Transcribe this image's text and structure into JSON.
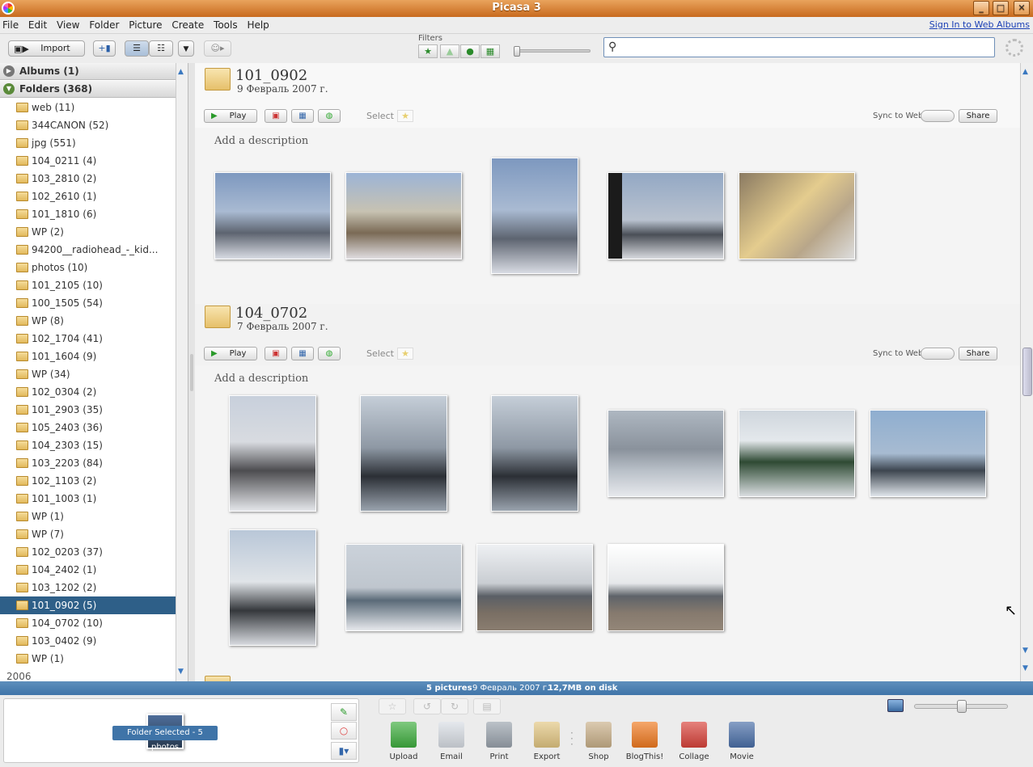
{
  "window": {
    "title": "Picasa 3",
    "min": "_",
    "max": "□",
    "close": "✕"
  },
  "menu": {
    "items": [
      "File",
      "Edit",
      "View",
      "Folder",
      "Picture",
      "Create",
      "Tools",
      "Help"
    ],
    "signin": "Sign In to Web Albums"
  },
  "toolbar": {
    "import": "Import",
    "filters_label": "Filters",
    "search_value": "",
    "search_placeholder": ""
  },
  "sidebar": {
    "albums": "Albums (1)",
    "folders": "Folders (368)",
    "items": [
      {
        "label": "web (11)"
      },
      {
        "label": "344CANON (52)"
      },
      {
        "label": "jpg (551)"
      },
      {
        "label": "104_0211 (4)"
      },
      {
        "label": "103_2810 (2)"
      },
      {
        "label": "102_2610 (1)"
      },
      {
        "label": "101_1810 (6)"
      },
      {
        "label": "WP (2)"
      },
      {
        "label": "94200__radiohead_-_kid..."
      },
      {
        "label": "photos (10)"
      },
      {
        "label": "101_2105 (10)"
      },
      {
        "label": "100_1505 (54)"
      },
      {
        "label": "WP (8)"
      },
      {
        "label": "102_1704 (41)"
      },
      {
        "label": "101_1604 (9)"
      },
      {
        "label": "WP (34)"
      },
      {
        "label": "102_0304 (2)"
      },
      {
        "label": "101_2903 (35)"
      },
      {
        "label": "105_2403 (36)"
      },
      {
        "label": "104_2303 (15)"
      },
      {
        "label": "103_2203 (84)"
      },
      {
        "label": "102_1103 (2)"
      },
      {
        "label": "101_1003 (1)"
      },
      {
        "label": "WP (1)"
      },
      {
        "label": "WP (7)"
      },
      {
        "label": "102_0203 (37)"
      },
      {
        "label": "104_2402 (1)"
      },
      {
        "label": "103_1202 (2)"
      },
      {
        "label": "101_0902 (5)",
        "selected": true
      },
      {
        "label": "104_0702 (10)"
      },
      {
        "label": "103_0402 (9)"
      },
      {
        "label": "WP (1)"
      }
    ],
    "year": "2006"
  },
  "folders": [
    {
      "name": "101_0902",
      "date": "9 Февраль 2007 г.",
      "play": "Play",
      "select": "Select",
      "sync": "Sync to Web",
      "share": "Share",
      "description": "Add a description",
      "photo_count": 5
    },
    {
      "name": "104_0702",
      "date": "7 Февраль 2007 г.",
      "play": "Play",
      "select": "Select",
      "sync": "Sync to Web",
      "share": "Share",
      "description": "Add a description",
      "photo_count": 10
    }
  ],
  "status": {
    "pictures": "5 pictures",
    "date": "9 Февраль 2007 г.",
    "size": "12,7MB on disk"
  },
  "tray": {
    "label": "Folder Selected - 5 photos"
  },
  "actions": [
    {
      "label": "Upload",
      "color": "#3fae3f"
    },
    {
      "label": "Email",
      "color": "#d8dde4"
    },
    {
      "label": "Print",
      "color": "#9aa3ad"
    },
    {
      "label": "Export",
      "color": "#e2c682"
    },
    {
      "label": "Shop",
      "color": "#c9b089"
    },
    {
      "label": "BlogThis!",
      "color": "#f07a20"
    },
    {
      "label": "Collage",
      "color": "#d9433b"
    },
    {
      "label": "Movie",
      "color": "#4a6fa8"
    }
  ],
  "colors": {
    "title_orange": "#d47a2c",
    "selection_blue": "#2e5f88",
    "status_blue": "#3f74a8"
  }
}
